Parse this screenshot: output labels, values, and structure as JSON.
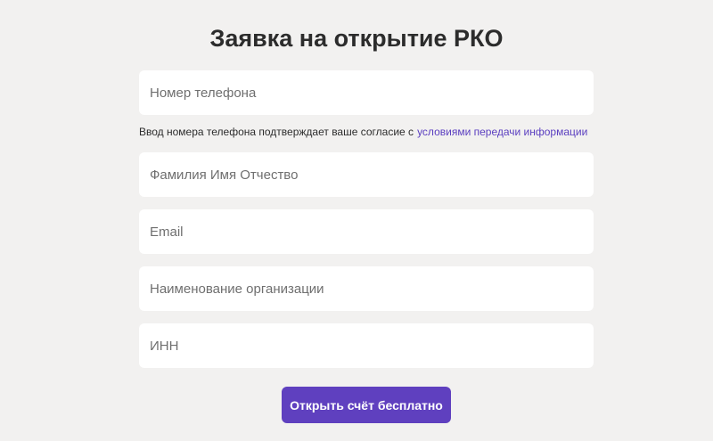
{
  "form": {
    "title": "Заявка на открытие РКО",
    "fields": {
      "phone": {
        "placeholder": "Номер телефона",
        "value": ""
      },
      "full_name": {
        "placeholder": "Фамилия Имя Отчество",
        "value": ""
      },
      "email": {
        "placeholder": "Email",
        "value": ""
      },
      "organization": {
        "placeholder": "Наименование организации",
        "value": ""
      },
      "inn": {
        "placeholder": "ИНН",
        "value": ""
      }
    },
    "consent": {
      "text": "Ввод номера телефона подтверждает ваше согласие с",
      "link_label": "условиями передачи информации"
    },
    "submit_label": "Открыть счёт бесплатно"
  },
  "colors": {
    "background": "#f2f1f0",
    "field_background": "#ffffff",
    "accent": "#5f40bf",
    "link": "#5b3fc0"
  }
}
